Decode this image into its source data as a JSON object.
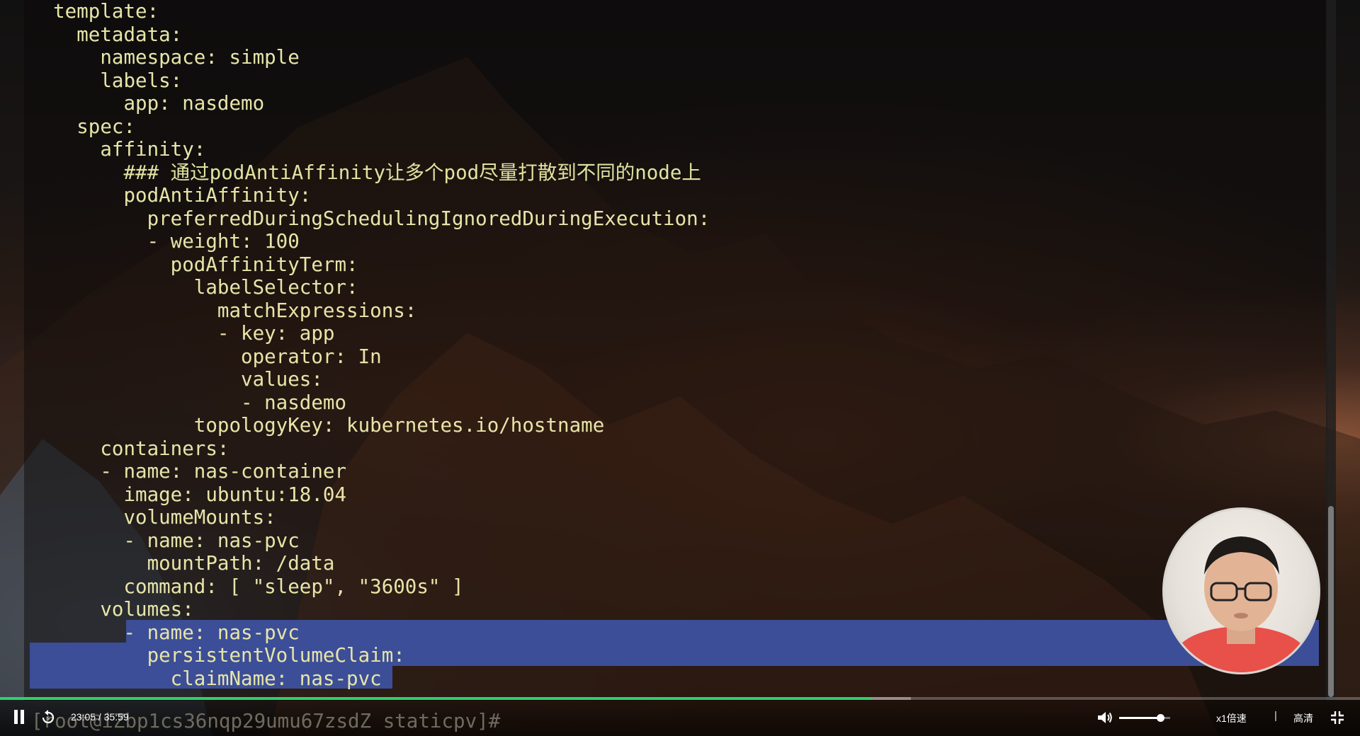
{
  "terminal": {
    "code_lines": [
      "  template:",
      "    metadata:",
      "      namespace: simple",
      "      labels:",
      "        app: nasdemo",
      "    spec:",
      "      affinity:",
      "        ### 通过podAntiAffinity让多个pod尽量打散到不同的node上",
      "        podAntiAffinity:",
      "          preferredDuringSchedulingIgnoredDuringExecution:",
      "          - weight: 100",
      "            podAffinityTerm:",
      "              labelSelector:",
      "                matchExpressions:",
      "                - key: app",
      "                  operator: In",
      "                  values:",
      "                  - nasdemo",
      "              topologyKey: kubernetes.io/hostname",
      "      containers:",
      "      - name: nas-container",
      "        image: ubuntu:18.04",
      "        volumeMounts:",
      "        - name: nas-pvc",
      "          mountPath: /data",
      "        command: [ \"sleep\", \"3600s\" ]",
      "      volumes:",
      "        - name: nas-pvc",
      "          persistentVolumeClaim:",
      "            claimName: nas-pvc"
    ],
    "prompt": "[root@iZbp1cs36nqp29umu67zsdZ staticpv]#",
    "text_color": "#e7e5a8",
    "selection_color": "#3c4e97"
  },
  "player": {
    "time": "23:05 / 35:59",
    "progress_fraction": 0.6411,
    "buffered_fraction": 0.67,
    "volume_fraction": 0.8,
    "speed_label": "x1倍速",
    "separator": "|",
    "quality_label": "高清",
    "progress_color": "#2fd06b",
    "icons": [
      "pause-icon",
      "replay-icon",
      "volume-icon",
      "fullscreen-icon"
    ]
  }
}
